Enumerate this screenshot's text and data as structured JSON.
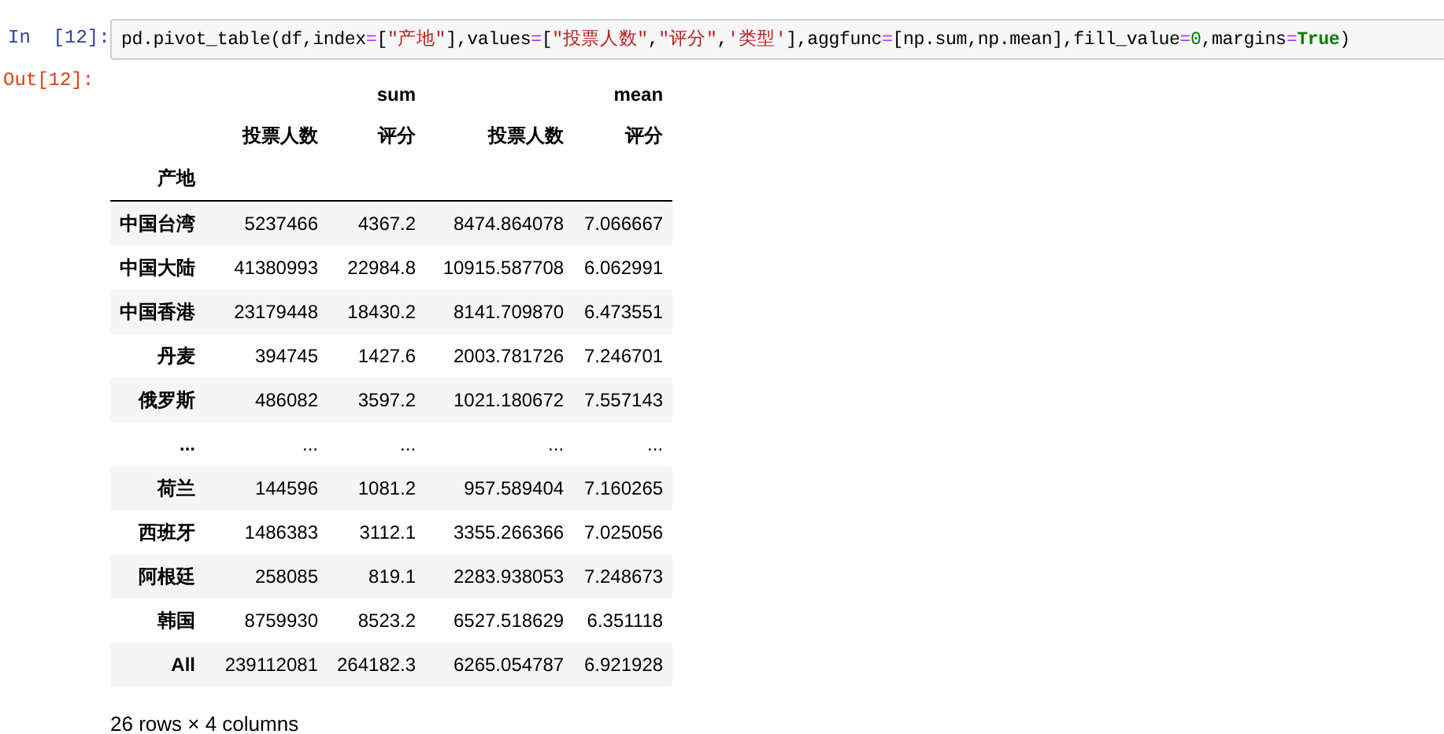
{
  "input_prompt": "In  [12]:",
  "code": [
    {
      "kind": "plain",
      "text": "pd.pivot_table(df,index"
    },
    {
      "kind": "operator",
      "text": "="
    },
    {
      "kind": "plain",
      "text": "["
    },
    {
      "kind": "string",
      "text": "\"产地\""
    },
    {
      "kind": "plain",
      "text": "],values"
    },
    {
      "kind": "operator",
      "text": "="
    },
    {
      "kind": "plain",
      "text": "["
    },
    {
      "kind": "string",
      "text": "\"投票人数\""
    },
    {
      "kind": "plain",
      "text": ","
    },
    {
      "kind": "string",
      "text": "\"评分\""
    },
    {
      "kind": "plain",
      "text": ","
    },
    {
      "kind": "string",
      "text": "'类型'"
    },
    {
      "kind": "plain",
      "text": "],aggfunc"
    },
    {
      "kind": "operator",
      "text": "="
    },
    {
      "kind": "plain",
      "text": "[np.sum,np.mean],fill_value"
    },
    {
      "kind": "operator",
      "text": "="
    },
    {
      "kind": "number",
      "text": "0"
    },
    {
      "kind": "plain",
      "text": ",margins"
    },
    {
      "kind": "operator",
      "text": "="
    },
    {
      "kind": "keyword",
      "text": "True"
    },
    {
      "kind": "plain",
      "text": ")"
    }
  ],
  "output_prompt": "Out[12]:",
  "table": {
    "header_top": [
      "sum",
      "mean"
    ],
    "header_columns": [
      "投票人数",
      "评分",
      "投票人数",
      "评分"
    ],
    "index_name": "产地",
    "rows": [
      [
        "中国台湾",
        "5237466",
        "4367.2",
        "8474.864078",
        "7.066667"
      ],
      [
        "中国大陆",
        "41380993",
        "22984.8",
        "10915.587708",
        "6.062991"
      ],
      [
        "中国香港",
        "23179448",
        "18430.2",
        "8141.709870",
        "6.473551"
      ],
      [
        "丹麦",
        "394745",
        "1427.6",
        "2003.781726",
        "7.246701"
      ],
      [
        "俄罗斯",
        "486082",
        "3597.2",
        "1021.180672",
        "7.557143"
      ],
      [
        "...",
        "...",
        "...",
        "...",
        "..."
      ],
      [
        "荷兰",
        "144596",
        "1081.2",
        "957.589404",
        "7.160265"
      ],
      [
        "西班牙",
        "1486383",
        "3112.1",
        "3355.266366",
        "7.025056"
      ],
      [
        "阿根廷",
        "258085",
        "819.1",
        "2283.938053",
        "7.248673"
      ],
      [
        "韩国",
        "8759930",
        "8523.2",
        "6527.518629",
        "6.351118"
      ],
      [
        "All",
        "239112081",
        "264182.3",
        "6265.054787",
        "6.921928"
      ]
    ]
  },
  "footer": "26 rows × 4 columns"
}
